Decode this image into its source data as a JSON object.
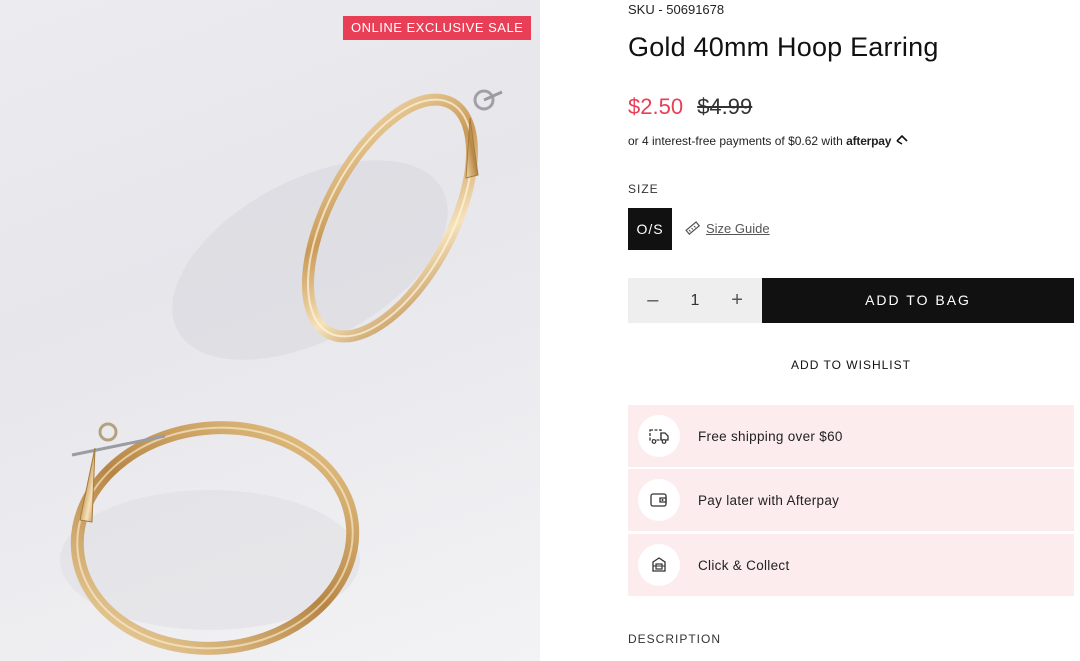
{
  "product": {
    "badge": "ONLINE EXCLUSIVE SALE",
    "sku": "SKU - 50691678",
    "title": "Gold 40mm Hoop Earring",
    "price_now": "$2.50",
    "price_was": "$4.99",
    "afterpay_text": "or 4 interest-free payments of $0.62 with",
    "afterpay_brand": "afterpay"
  },
  "size": {
    "label": "SIZE",
    "option": "O/S",
    "guide": "Size Guide"
  },
  "purchase": {
    "qty_minus": "–",
    "qty": "1",
    "qty_plus": "+",
    "add_to_bag": "ADD TO BAG",
    "wishlist": "ADD TO WISHLIST"
  },
  "perks": [
    {
      "label": "Free shipping over $60",
      "icon": "truck-icon"
    },
    {
      "label": "Pay later with Afterpay",
      "icon": "wallet-icon"
    },
    {
      "label": "Click & Collect",
      "icon": "store-icon"
    }
  ],
  "description_label": "DESCRIPTION",
  "colors": {
    "accent": "#e83e56",
    "perk_bg": "#fcecee",
    "dark": "#111111"
  }
}
